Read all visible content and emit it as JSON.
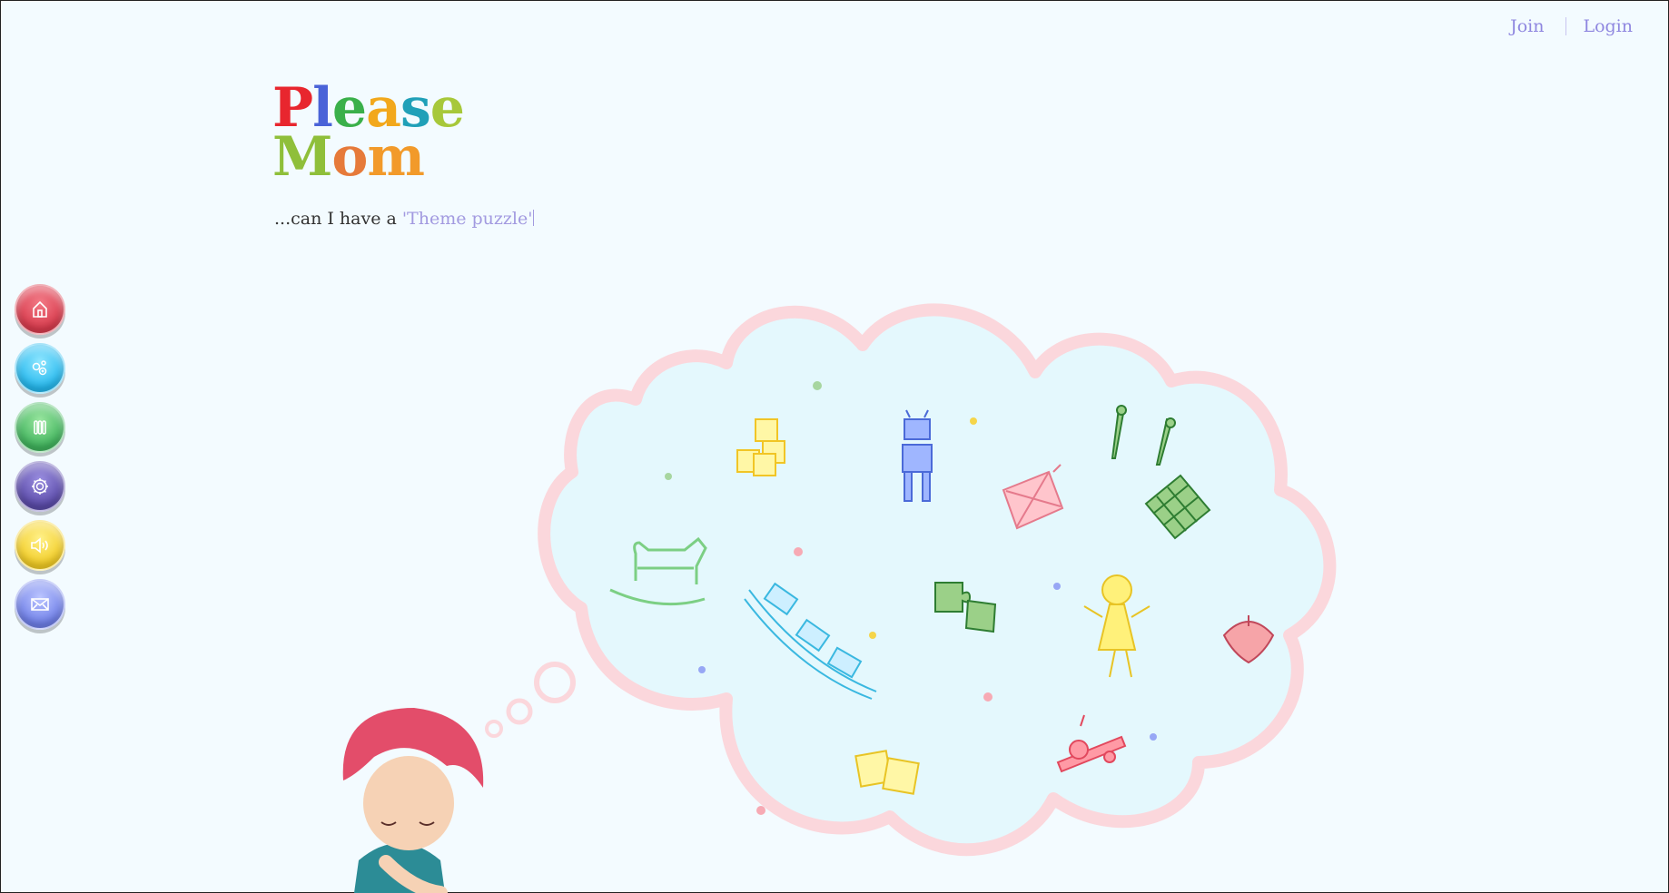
{
  "topnav": {
    "join_label": "Join",
    "login_label": "Login"
  },
  "logo": {
    "line1": [
      "P",
      "l",
      "e",
      "a",
      "s",
      "e"
    ],
    "line2": [
      "M",
      "o",
      "m"
    ],
    "line1_colors": [
      "#e8262e",
      "#4a63d8",
      "#3ab04a",
      "#f2a81c",
      "#20a0b8",
      "#a7c83a"
    ],
    "line2_colors": [
      "#8fbf3a",
      "#e67a3a",
      "#f29a2a"
    ]
  },
  "tagline": {
    "lead": "...can I have a",
    "highlight": "'Theme puzzle'"
  },
  "sidebar": {
    "buttons": [
      {
        "icon": "home-icon",
        "color": "#d83a4c"
      },
      {
        "icon": "puzzle-icon",
        "color": "#24b8ee"
      },
      {
        "icon": "pause-icon",
        "color": "#3fb35c"
      },
      {
        "icon": "gear-icon",
        "color": "#5a4aa8"
      },
      {
        "icon": "speaker-icon",
        "color": "#f2cc24"
      },
      {
        "icon": "mail-icon",
        "color": "#6e7ee8"
      }
    ]
  },
  "illustration": {
    "toys": [
      "abc-blocks-icon",
      "robot-icon",
      "wagon-icon",
      "tweezers-icon",
      "waffle-icon",
      "rocking-horse-icon",
      "train-icon",
      "puzzle-pieces-icon",
      "doll-icon",
      "spinning-top-icon",
      "dice-icon",
      "toy-plane-icon"
    ],
    "colors": {
      "cloud_fill": "#e4f8fd",
      "cloud_border": "#fbd7dc"
    }
  }
}
